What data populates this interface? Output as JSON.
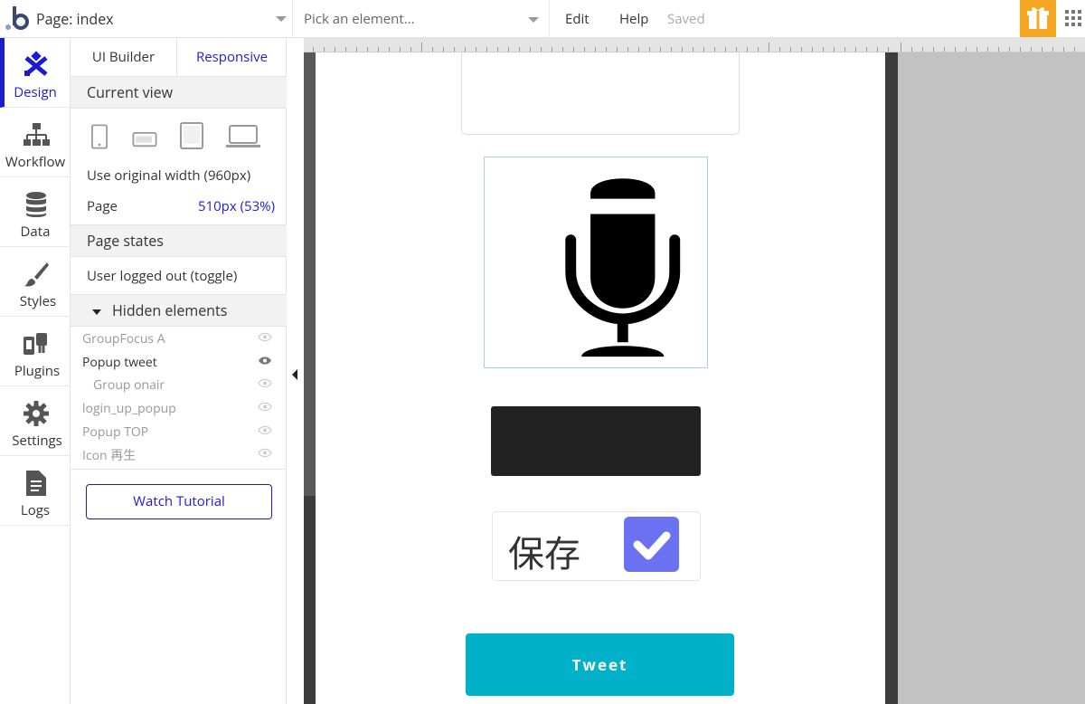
{
  "topbar": {
    "page_label": "Page: index",
    "element_placeholder": "Pick an element...",
    "menu_edit": "Edit",
    "menu_help": "Help",
    "save_status": "Saved"
  },
  "rail": {
    "items": [
      {
        "label": "Design",
        "icon": "design-icon"
      },
      {
        "label": "Workflow",
        "icon": "workflow-icon"
      },
      {
        "label": "Data",
        "icon": "database-icon"
      },
      {
        "label": "Styles",
        "icon": "brush-icon"
      },
      {
        "label": "Plugins",
        "icon": "plug-icon"
      },
      {
        "label": "Settings",
        "icon": "gear-icon"
      },
      {
        "label": "Logs",
        "icon": "document-icon"
      }
    ],
    "active_color": "#1e1bcf"
  },
  "panel": {
    "tab_ui": "UI Builder",
    "tab_responsive": "Responsive",
    "current_view": "Current view",
    "original_width": "Use original width (960px)",
    "page_label": "Page",
    "page_value": "510px (53%)",
    "page_states": "Page states",
    "user_state": "User logged out (toggle)",
    "hidden_elements": "Hidden elements",
    "hidden_items": [
      {
        "label": "GroupFocus A"
      },
      {
        "label": "Popup tweet"
      },
      {
        "label": "Group onair"
      },
      {
        "label": "login_up_popup"
      },
      {
        "label": "Popup TOP"
      },
      {
        "label": "Icon 再生"
      }
    ],
    "watch_tutorial": "Watch Tutorial"
  },
  "canvas": {
    "save_label": "保存",
    "save_checked": true,
    "tweet_button": "Tweet",
    "accent": "#00b1c9",
    "checkbox_color": "#6b72f1"
  }
}
